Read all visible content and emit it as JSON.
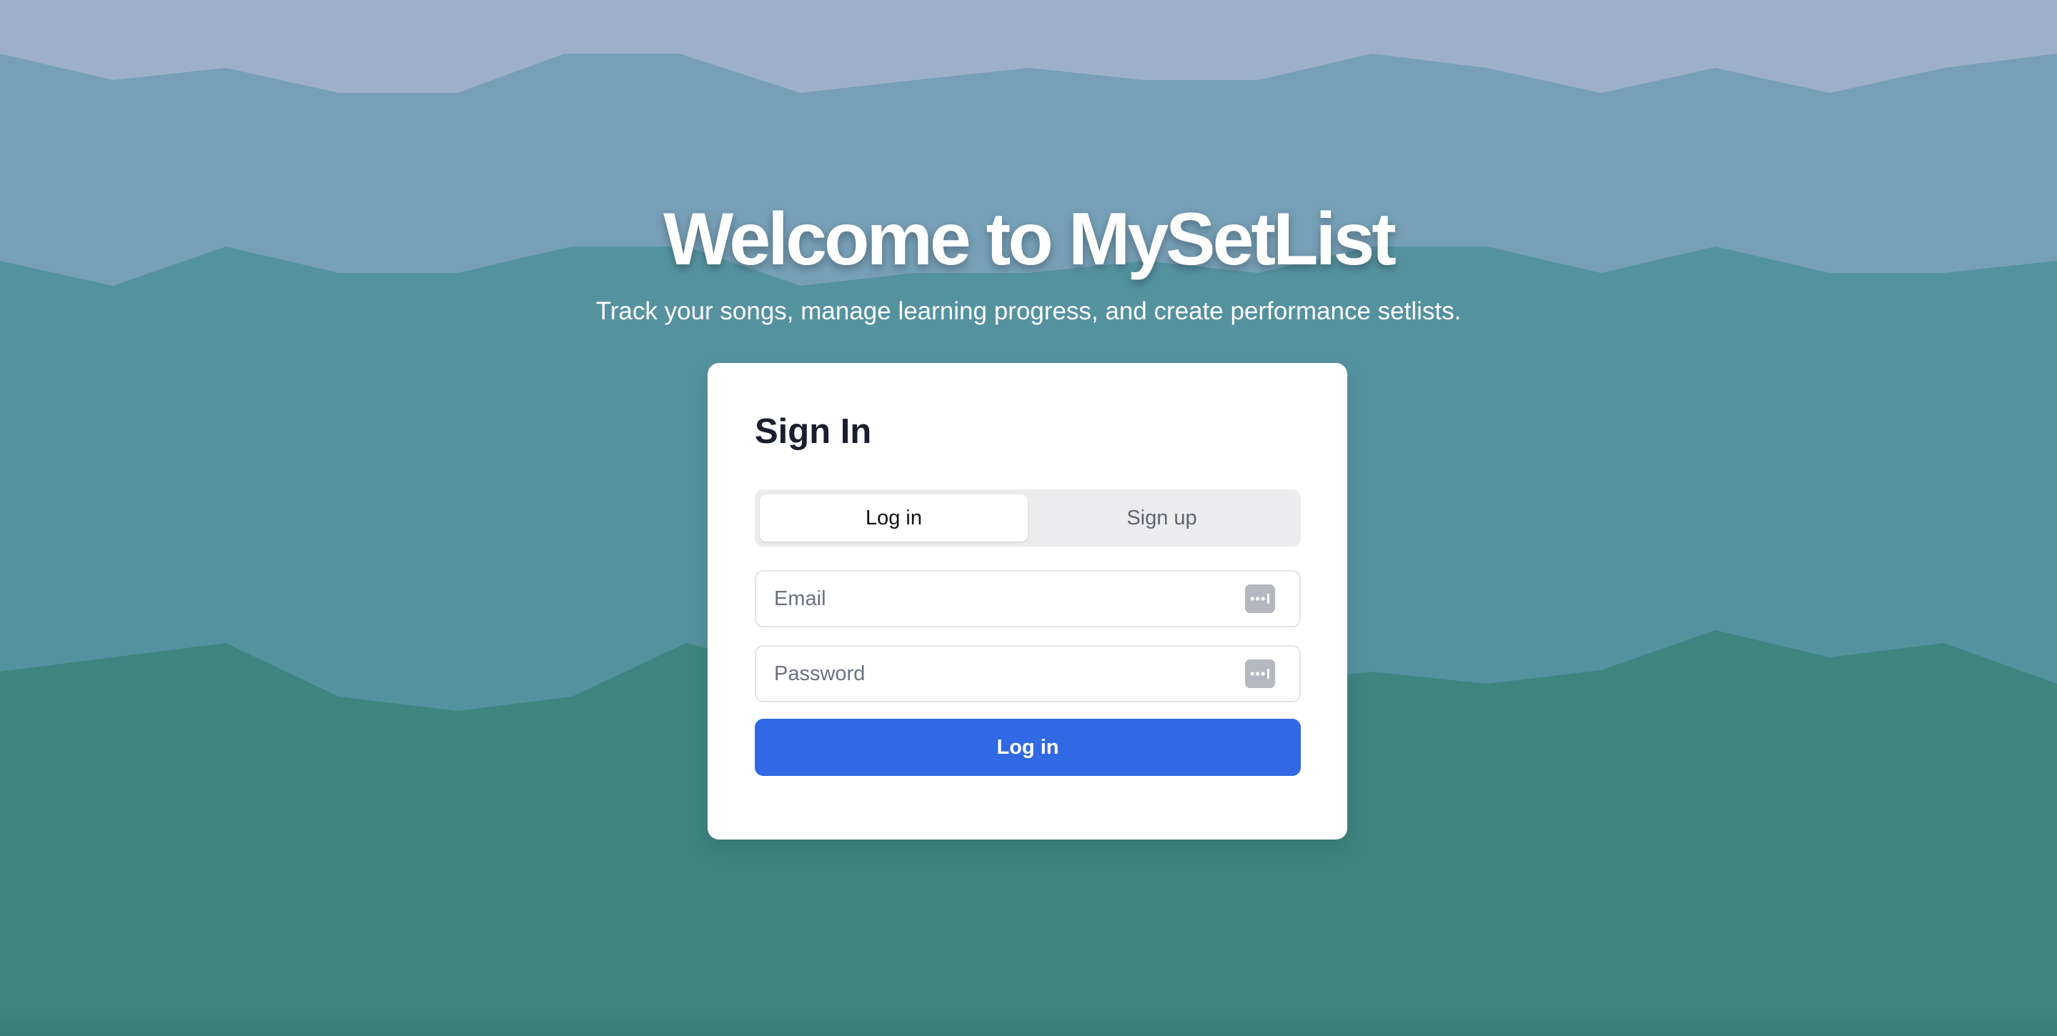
{
  "hero": {
    "title": "Welcome to MySetList",
    "subtitle": "Track your songs, manage learning progress, and create performance setlists."
  },
  "signin": {
    "title": "Sign In",
    "tabs": [
      {
        "label": "Log in",
        "active": true
      },
      {
        "label": "Sign up",
        "active": false
      }
    ],
    "email": {
      "placeholder": "Email",
      "value": ""
    },
    "password": {
      "placeholder": "Password",
      "value": ""
    },
    "field_icon": "password-manager-icon",
    "submit_label": "Log in"
  },
  "colors": {
    "sky": "#9eb0c9",
    "far_hills": "#77a0b8",
    "mid_hills": "#5592a0",
    "near_hills": "#3e8580",
    "primary_button": "#3069e3",
    "card": "#ffffff"
  }
}
